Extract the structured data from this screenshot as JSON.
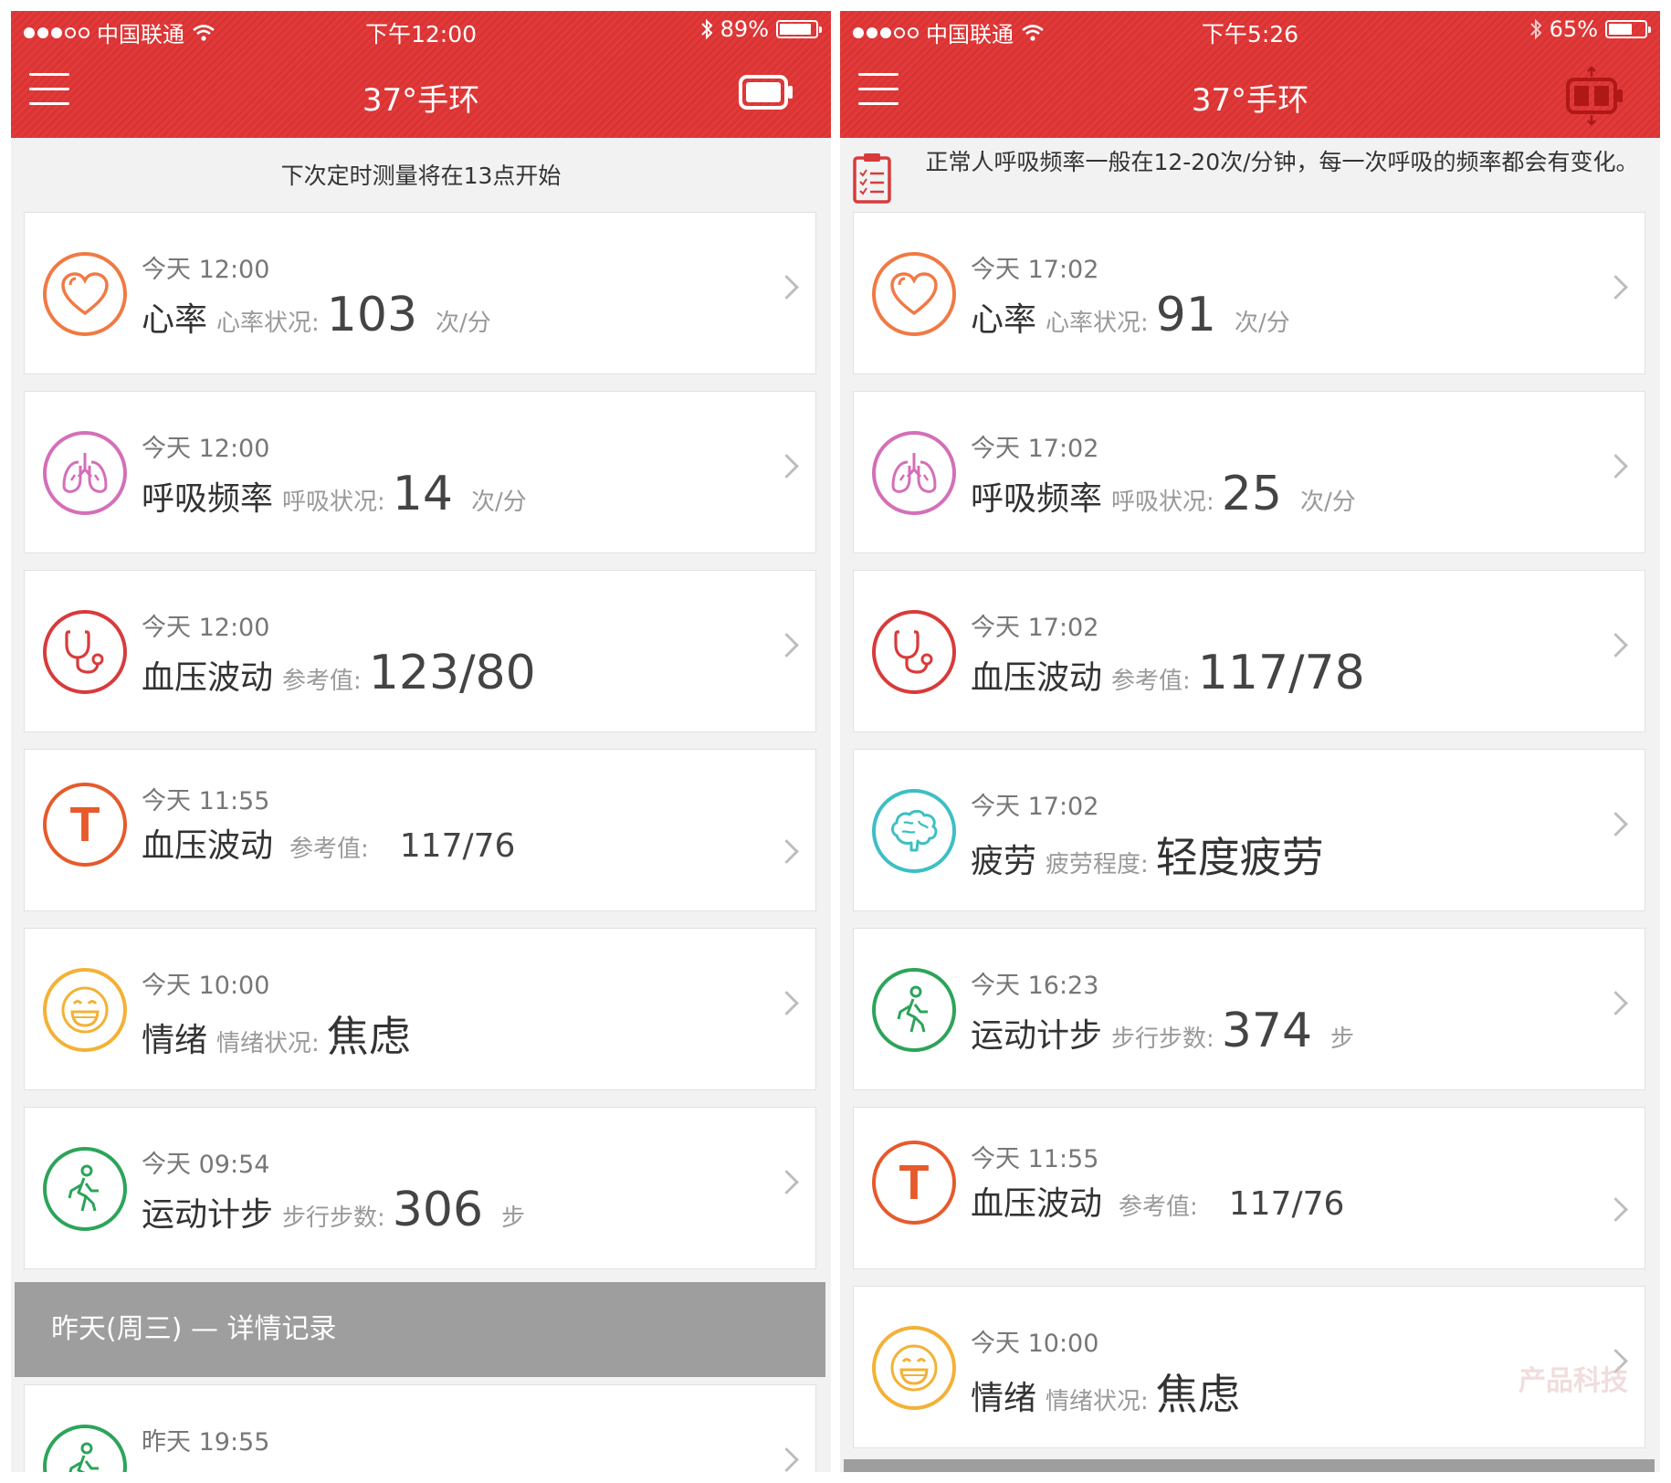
{
  "colors": {
    "brand_red": "#e23a3a",
    "heart": "#f07a44",
    "lung": "#d46fb8",
    "bp": "#d83b3b",
    "temp_t": "#e65a2c",
    "mood": "#f3b136",
    "walk": "#2ca45a",
    "brain": "#3dbfc4"
  },
  "left": {
    "status": {
      "carrier": "中国联通",
      "time": "下午12:00",
      "battery": "89%",
      "battery_level": 0.89
    },
    "nav": {
      "title": "37°手环",
      "right_icon": "battery-outline-icon"
    },
    "banner": {
      "text": "下次定时测量将在13点开始"
    },
    "cards": [
      {
        "icon": "heart-icon",
        "time": "今天 12:00",
        "name": "心率",
        "label": "心率状况:",
        "value": "103",
        "unit": "次/分"
      },
      {
        "icon": "lungs-icon",
        "time": "今天 12:00",
        "name": "呼吸频率",
        "label": "呼吸状况:",
        "value": "14",
        "unit": "次/分"
      },
      {
        "icon": "stethoscope-icon",
        "time": "今天 12:00",
        "name": "血压波动",
        "label": "参考值:",
        "value": "123/80",
        "unit": ""
      },
      {
        "icon": "letter-t-icon",
        "time": "今天 11:55",
        "name": "血压波动",
        "label": "参考值:",
        "value": "117/76",
        "unit": ""
      },
      {
        "icon": "smiley-icon",
        "time": "今天 10:00",
        "name": "情绪",
        "label": "情绪状况:",
        "value": "焦虑",
        "unit": ""
      },
      {
        "icon": "walking-icon",
        "time": "今天 09:54",
        "name": "运动计步",
        "label": "步行步数:",
        "value": "306",
        "unit": "步"
      }
    ],
    "section": {
      "text": "昨天(周三) — 详情记录"
    },
    "partial_card": {
      "icon": "walking-icon",
      "time": "昨天 19:55"
    }
  },
  "right": {
    "status": {
      "carrier": "中国联通",
      "time": "下午5:26",
      "battery": "65%",
      "battery_level": 0.65
    },
    "nav": {
      "title": "37°手环",
      "right_icon": "battery-charging-icon"
    },
    "banner": {
      "text": "正常人呼吸频率一般在12-20次/分钟，每一次呼吸的频率都会有变化。",
      "icon": "clipboard-icon"
    },
    "cards": [
      {
        "icon": "heart-icon",
        "time": "今天 17:02",
        "name": "心率",
        "label": "心率状况:",
        "value": "91",
        "unit": "次/分"
      },
      {
        "icon": "lungs-icon",
        "time": "今天 17:02",
        "name": "呼吸频率",
        "label": "呼吸状况:",
        "value": "25",
        "unit": "次/分"
      },
      {
        "icon": "stethoscope-icon",
        "time": "今天 17:02",
        "name": "血压波动",
        "label": "参考值:",
        "value": "117/78",
        "unit": ""
      },
      {
        "icon": "brain-icon",
        "time": "今天 17:02",
        "name": "疲劳",
        "label": "疲劳程度:",
        "value": "轻度疲劳",
        "unit": ""
      },
      {
        "icon": "walking-icon",
        "time": "今天 16:23",
        "name": "运动计步",
        "label": "步行步数:",
        "value": "374",
        "unit": "步"
      },
      {
        "icon": "letter-t-icon",
        "time": "今天 11:55",
        "name": "血压波动",
        "label": "参考值:",
        "value": "117/76",
        "unit": ""
      },
      {
        "icon": "smiley-icon",
        "time": "今天 10:00",
        "name": "情绪",
        "label": "情绪状况:",
        "value": "焦虑",
        "unit": ""
      }
    ],
    "watermark": "产品科技"
  }
}
